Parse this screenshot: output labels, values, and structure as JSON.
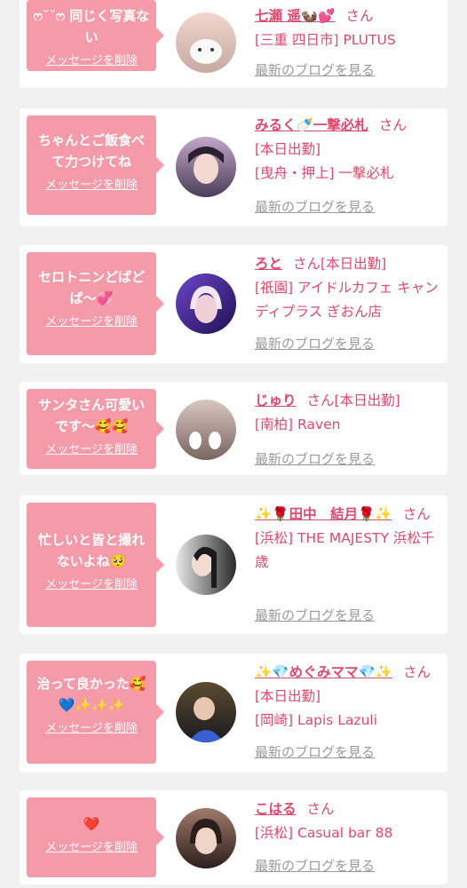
{
  "entries": [
    {
      "message": "ෆ˘˘ෆ 同じく写真ない",
      "delete_label": "メッセージを削除",
      "name": "七瀬 遥🦦💕",
      "honorific": "さん",
      "details": [
        "[三重 四日市] PLUTUS"
      ],
      "blog_label": "最新のブログを見る",
      "avatar_colors": [
        "#f1d7cf",
        "#c6a9a0"
      ]
    },
    {
      "message": "ちゃんとご飯食べて力つけてね",
      "delete_label": "メッセージを削除",
      "name": "みるく🍼一撃必札",
      "honorific": "さん",
      "details": [
        "[本日出勤]",
        "[曳舟・押上] 一撃必札"
      ],
      "blog_label": "最新のブログを見る",
      "avatar_colors": [
        "#c2a6c9",
        "#4a3e58"
      ]
    },
    {
      "message": "セロトニンどばどば〜💞",
      "delete_label": "メッセージを削除",
      "name": "ろと",
      "honorific": "さん",
      "details": [
        "[本日出勤]",
        "[祇園] アイドルカフェ キャンディプラス ぎおん店"
      ],
      "blog_label": "最新のブログを見る",
      "avatar_colors": [
        "#6b46c9",
        "#1f0f52"
      ]
    },
    {
      "message": "サンタさん可愛いです〜🥰🥰",
      "delete_label": "メッセージを削除",
      "name": "じゅり",
      "honorific": "さん",
      "details": [
        "[本日出勤]",
        "[南柏] Raven"
      ],
      "blog_label": "最新のブログを見る",
      "avatar_colors": [
        "#d8c7c0",
        "#7a6560"
      ]
    },
    {
      "message": "忙しいと皆と撮れないよね🥺",
      "delete_label": "メッセージを削除",
      "name": "✨🌹田中　結月🌹✨",
      "honorific": "さん",
      "details": [
        "[浜松] THE MAJESTY 浜松千歳"
      ],
      "blog_label": "最新のブログを見る",
      "avatar_colors": [
        "#e9e9e9",
        "#2a2a2a"
      ]
    },
    {
      "message": "治って良かった🥰💙✨✨✨",
      "delete_label": "メッセージを削除",
      "name": "✨💎めぐみママ💎✨",
      "honorific": "さん",
      "details": [
        "[本日出勤]",
        "[岡崎] Lapis Lazuli"
      ],
      "blog_label": "最新のブログを見る",
      "avatar_colors": [
        "#5a4a2f",
        "#1c1a20"
      ]
    },
    {
      "message": "❤️",
      "delete_label": "メッセージを削除",
      "name": "こはる",
      "honorific": "さん",
      "details": [
        "[浜松] Casual bar 88"
      ],
      "blog_label": "最新のブログを見る",
      "avatar_colors": [
        "#a07a6a",
        "#2c1f1c"
      ]
    }
  ]
}
